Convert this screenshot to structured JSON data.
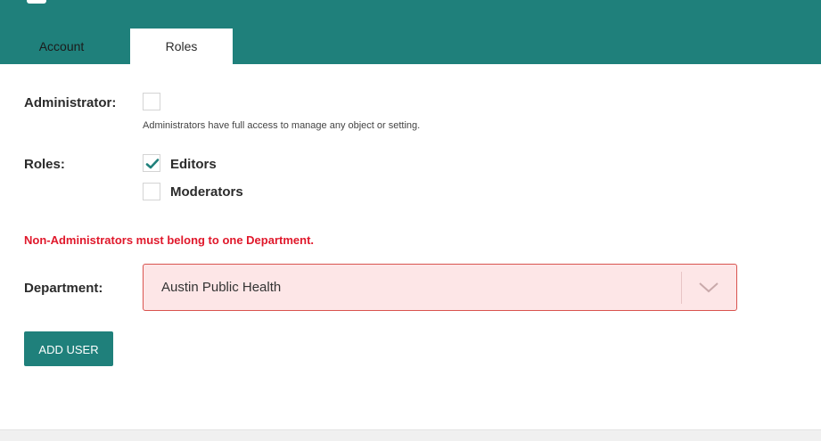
{
  "tabs": [
    {
      "label": "Account",
      "active": false
    },
    {
      "label": "Roles",
      "active": true
    }
  ],
  "administrator": {
    "label": "Administrator:",
    "checked": false,
    "help_text": "Administrators have full access to manage any object or setting."
  },
  "roles": {
    "label": "Roles:",
    "options": [
      {
        "label": "Editors",
        "checked": true
      },
      {
        "label": "Moderators",
        "checked": false
      }
    ]
  },
  "error_message": "Non-Administrators must belong to one Department.",
  "department": {
    "label": "Department:",
    "selected": "Austin Public Health"
  },
  "add_user_button": "ADD USER",
  "colors": {
    "brand": "#1f807b",
    "error": "#e0182b",
    "error_bg": "#fde6e7"
  }
}
